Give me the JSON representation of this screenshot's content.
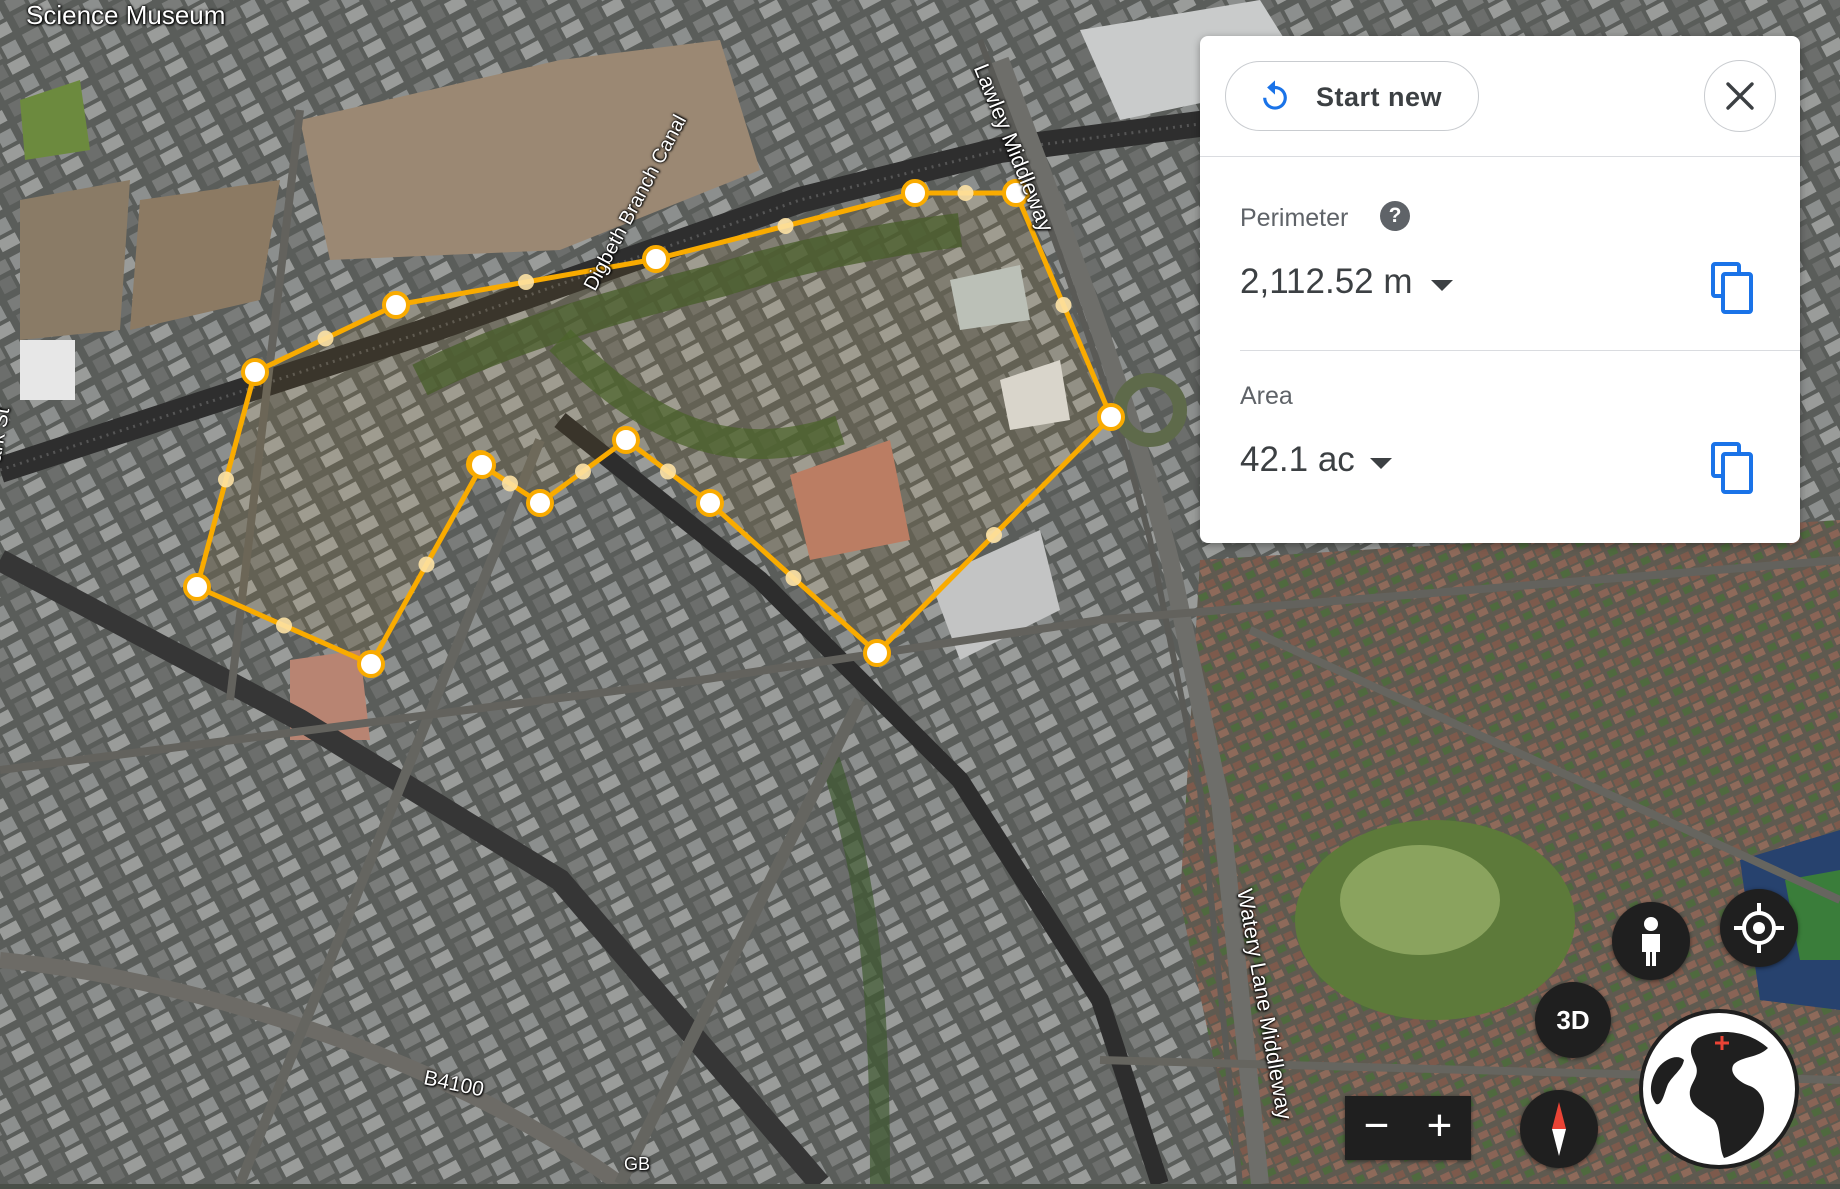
{
  "panel": {
    "start_new_label": "Start new",
    "perimeter": {
      "label": "Perimeter",
      "value": "2,112.52 m"
    },
    "area": {
      "label": "Area",
      "value": "42.1 ac"
    }
  },
  "map_labels": {
    "science_museum": "Science Museum",
    "digbeth_canal": "Digbeth Branch Canal",
    "lawley_middleway": "Lawley Middleway",
    "watery_lane": "Watery Lane Middleway",
    "b4100": "B4100",
    "park_st": "ark St",
    "gb": "GB"
  },
  "controls": {
    "btn_3d_label": "3D",
    "zoom_out": "−",
    "zoom_in": "+"
  },
  "colors": {
    "measure_line": "#f9ab00",
    "accent_blue": "#1a73e8"
  },
  "icons": [
    "refresh-icon",
    "close-icon",
    "help-icon",
    "copy-icon",
    "pegman-icon",
    "my-location-icon",
    "compass-icon",
    "globe-icon"
  ]
}
